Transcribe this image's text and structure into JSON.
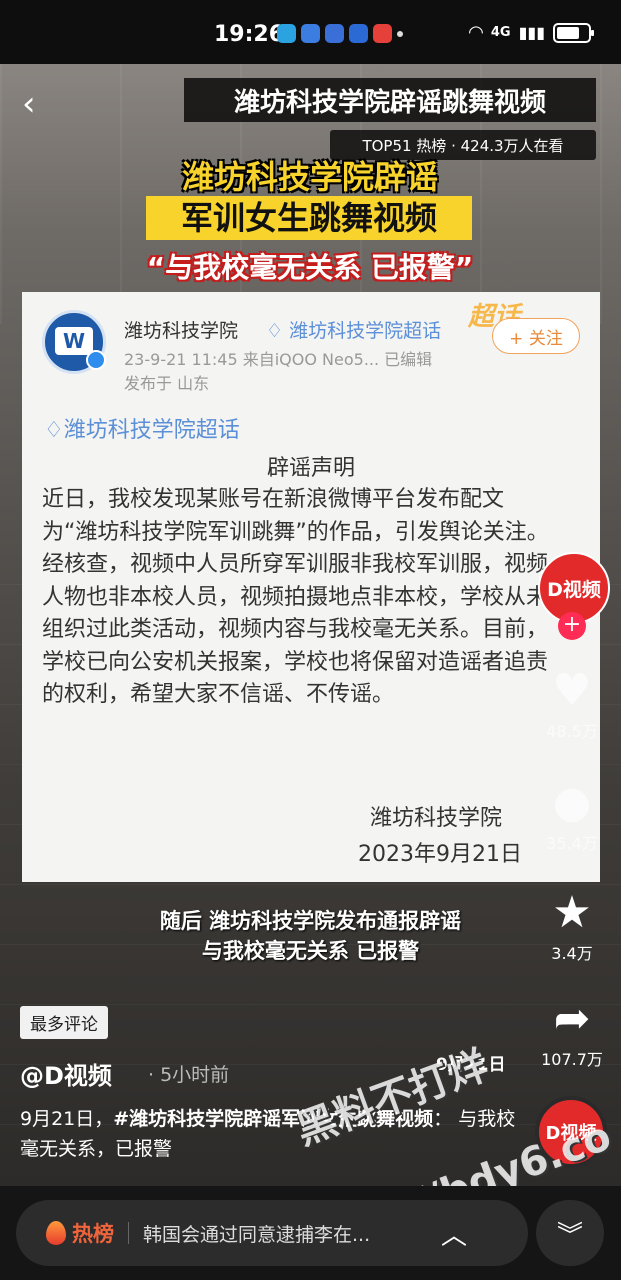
{
  "status_bar": {
    "time": "19:26",
    "network": "4G"
  },
  "header": {
    "title": "潍坊科技学院辟谣跳舞视频",
    "rank": "TOP51 热榜 · 424.3万人在看"
  },
  "video_overlay": {
    "headline1": "潍坊科技学院辟谣",
    "headline2": "军训女生跳舞视频",
    "headline3": "“与我校毫无关系 已报警”",
    "subtitle1": "随后 潍坊科技学院发布通报辟谣",
    "subtitle2": "与我校毫无关系 已报警"
  },
  "weibo_card": {
    "account_name": "潍坊科技学院",
    "account_tag": "♢ 潍坊科技学院超话",
    "meta": "23-9-21 11:45  来自iQOO Neo5...  已编辑",
    "location": "发布于 山东",
    "follow_label": "+ 关注",
    "chaohua_logo": "超话",
    "topic": "♢潍坊科技学院超话",
    "statement_title": "辟谣声明",
    "body": "近日，我校发现某账号在新浪微博平台发布配文为“潍坊科技学院军训跳舞”的作品，引发舆论关注。经核查，视频中人员所穿军训服非我校军训服，视频人物也非本校人员，视频拍摄地点非本校，学校从未组织过此类活动，视频内容与我校毫无关系。目前，学校已向公安机关报案，学校也将保留对造谣者追责的权利，希望大家不信谣、不传谣。",
    "sign_org": "潍坊科技学院",
    "sign_date": "2023年9月21日"
  },
  "rail": {
    "avatar_label": "D视频",
    "likes": "48.5万",
    "comments": "35.4万",
    "favorites": "3.4万",
    "shares": "107.7万",
    "disc_label": "D视频"
  },
  "post": {
    "most_comments": "最多评论",
    "date_label": "9月21日",
    "author": "@D视频",
    "time": "· 5小时前",
    "caption_prefix": "9月21日，",
    "caption_tag": "#潍坊科技学院辟谣军训女生跳舞视频",
    "caption_rest": "： 与我校毫无关系，已报警"
  },
  "watermark": {
    "line1": "黑料不打烊",
    "line2": "https://bdy6.co"
  },
  "bottom_bar": {
    "hot_label": "热榜",
    "hot_text": "韩国会通过同意逮捕李在...",
    "up_icon": "chevron-up-icon",
    "expand_icon": "double-chevron-down-icon"
  }
}
